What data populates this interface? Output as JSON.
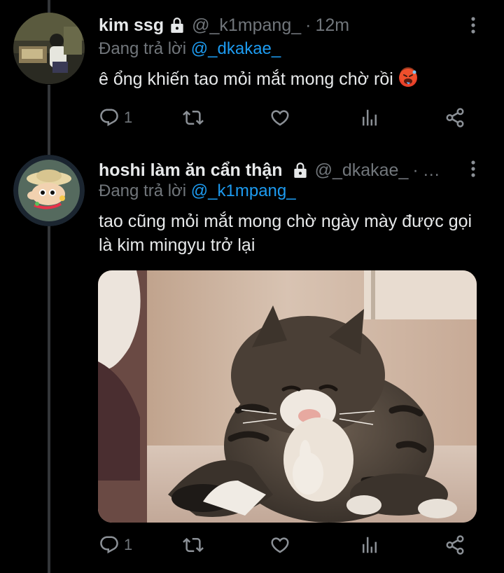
{
  "tweets": [
    {
      "name": "kim ssg",
      "handle": "@_k1mpang_",
      "separator": "·",
      "time": "12m",
      "reply_prefix": "Đang trả lời",
      "reply_to": "@_dkakae_",
      "text": "ê ổng khiến tao mỏi mắt mong chờ rồi",
      "emoji": "hot-face-emoji",
      "reply_count": "1",
      "icons": {
        "lock": "lock-icon",
        "more": "more-vertical-icon",
        "reply": "reply-icon",
        "retweet": "retweet-icon",
        "like": "heart-icon",
        "stats": "stats-icon",
        "share": "share-icon"
      }
    },
    {
      "name": "hoshi làm ăn cẩn thận",
      "handle": "@_dkakae_",
      "separator": "·",
      "time": "…",
      "reply_prefix": "Đang trả lời",
      "reply_to": "@_k1mpang_",
      "text": "tao cũng mỏi mắt mong chờ ngày mày được gọi là kim mingyu trở lại",
      "media": "cat-thumbs-up-photo",
      "reply_count": "1",
      "icons": {
        "lock": "lock-icon",
        "more": "more-vertical-icon",
        "reply": "reply-icon",
        "retweet": "retweet-icon",
        "like": "heart-icon",
        "stats": "stats-icon",
        "share": "share-icon"
      }
    }
  ],
  "colors": {
    "background": "#000000",
    "text": "#e7e9ea",
    "secondary": "#71767b",
    "link": "#1d9bf0",
    "thread_line": "#333639"
  }
}
